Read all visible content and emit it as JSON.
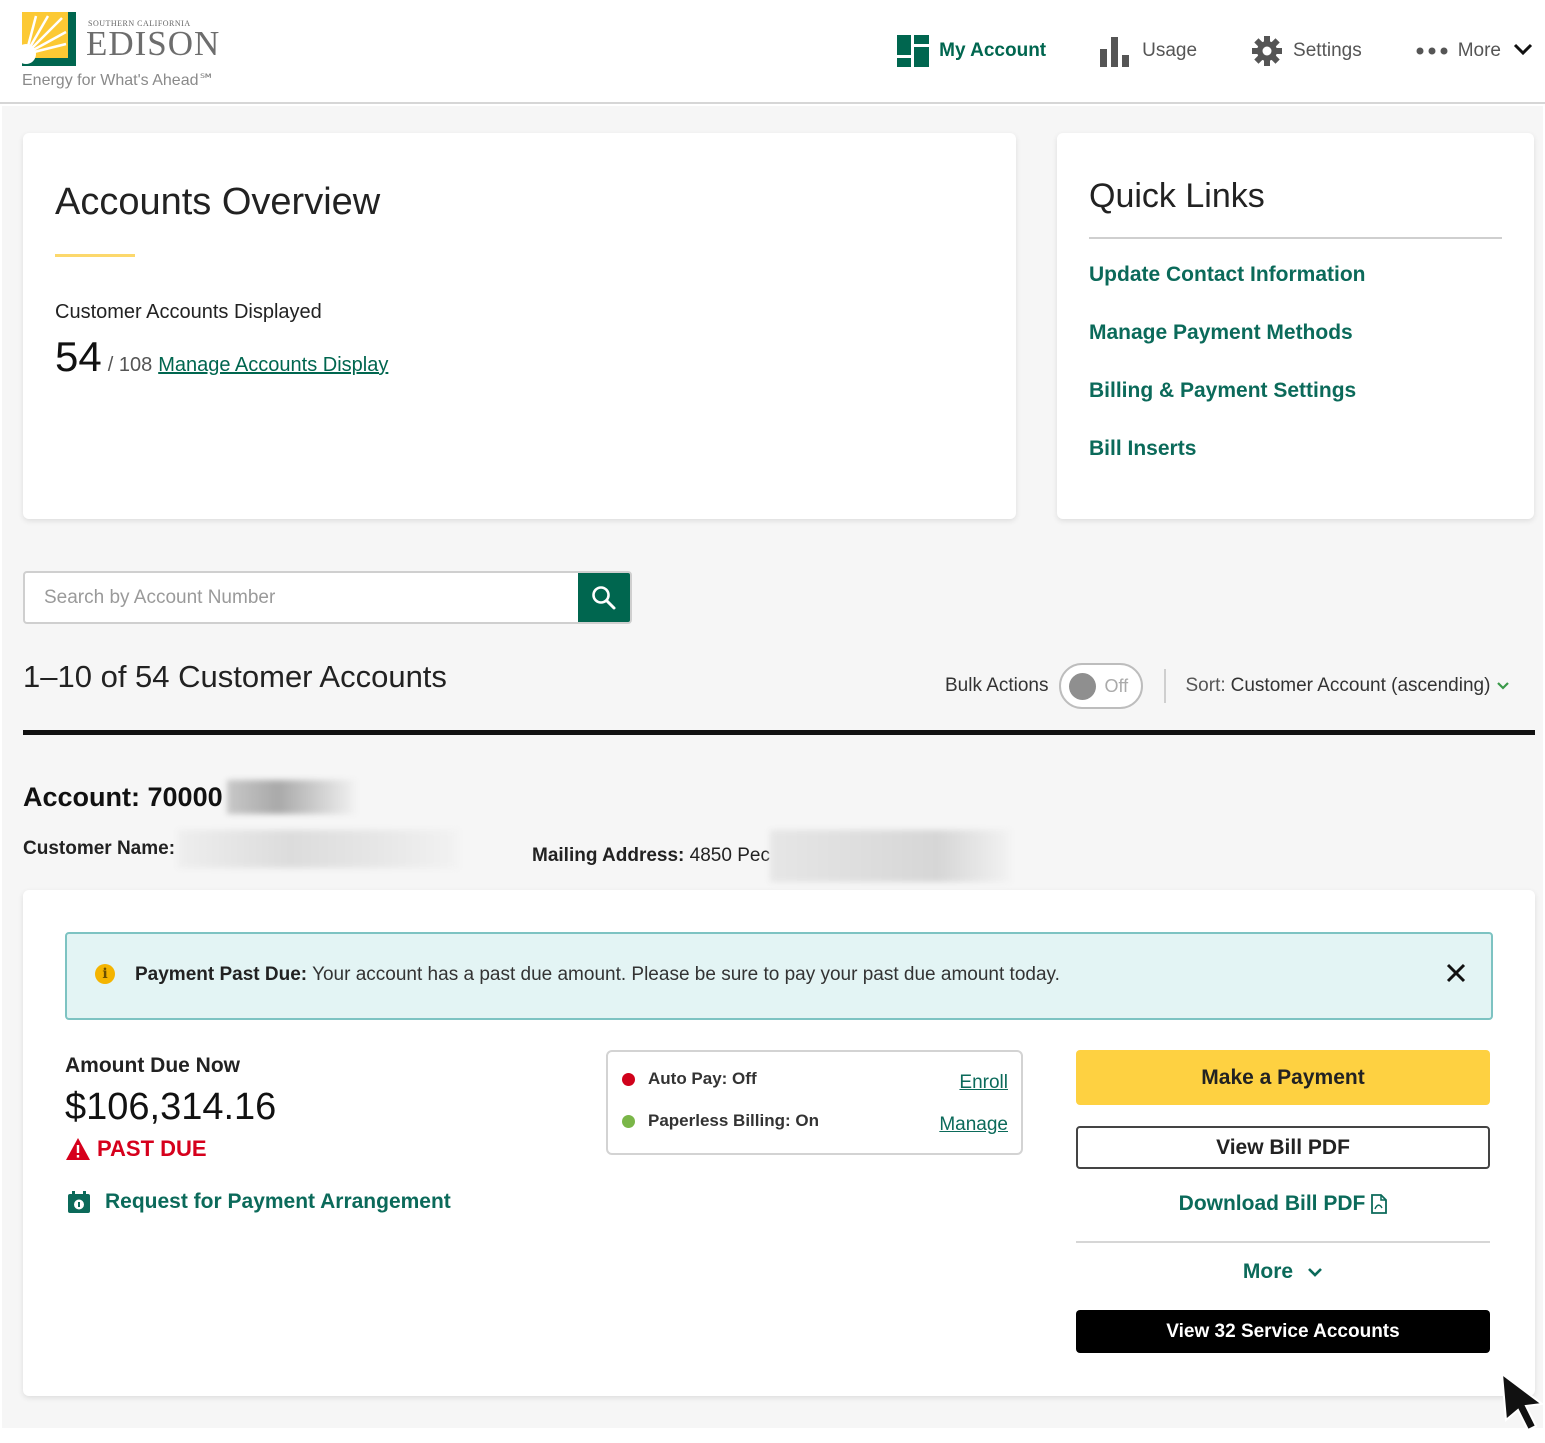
{
  "header": {
    "logo": {
      "small_text": "SOUTHERN CALIFORNIA",
      "brand": "EDISON",
      "tagline": "Energy for What's Ahead℠"
    },
    "nav": [
      {
        "label": "My Account",
        "icon": "dashboard-icon",
        "active": true
      },
      {
        "label": "Usage",
        "icon": "bar-chart-icon",
        "active": false
      },
      {
        "label": "Settings",
        "icon": "gear-icon",
        "active": false
      },
      {
        "label": "More",
        "icon": "more-dots-icon",
        "active": false
      }
    ]
  },
  "overview": {
    "title": "Accounts Overview",
    "displayed_label": "Customer Accounts Displayed",
    "displayed_count": "54",
    "total": "/ 108",
    "manage_link": "Manage Accounts Display"
  },
  "quick_links": {
    "title": "Quick Links",
    "items": [
      "Update Contact Information",
      "Manage Payment Methods",
      "Billing & Payment Settings",
      "Bill Inserts"
    ]
  },
  "search": {
    "placeholder": "Search by Account Number",
    "value": ""
  },
  "results": {
    "title": "1–10 of 54 Customer Accounts",
    "bulk_actions_label": "Bulk Actions",
    "bulk_actions_state": "Off",
    "sort_key": "Sort:",
    "sort_value": "Customer Account (ascending)"
  },
  "account": {
    "number_label": "Account:",
    "number_visible": "70000",
    "customer_name_label": "Customer Name:",
    "mailing_address_label": "Mailing Address:",
    "mailing_address_visible": "4850 Pec",
    "alert": {
      "title": "Payment Past Due:",
      "message": "Your account has a past due amount. Please be sure to pay your past due amount today."
    },
    "amount_due_label": "Amount Due Now",
    "amount_due": "$106,314.16",
    "past_due_label": "PAST DUE",
    "arrangement_link": "Request for Payment Arrangement",
    "status": [
      {
        "label": "Auto Pay: Off",
        "color": "#d0021b",
        "link": "Enroll"
      },
      {
        "label": "Paperless Billing: On",
        "color": "#7ab648",
        "link": "Manage"
      }
    ],
    "actions": {
      "make_payment": "Make a Payment",
      "view_bill": "View Bill PDF",
      "download_bill": "Download Bill PDF",
      "more": "More",
      "view_service": "View 32 Service Accounts"
    }
  },
  "colors": {
    "brand_green": "#00664f",
    "link_green": "#0b6a5a",
    "brand_yellow": "#fed141",
    "danger_red": "#d6001c",
    "alert_bg": "#e3f4f4"
  }
}
